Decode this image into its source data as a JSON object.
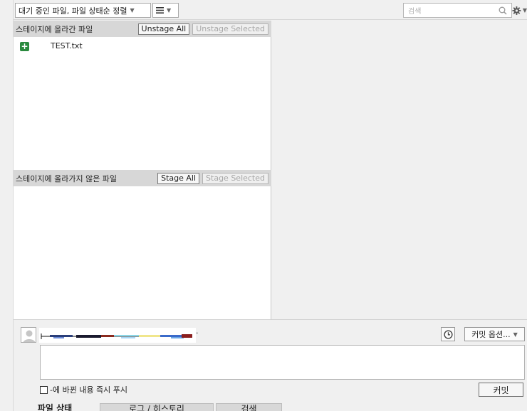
{
  "toolbar": {
    "view_mode": "대기 중인 파일, 파일 상태순 정렬",
    "list_icon": "list-icon",
    "search_placeholder": "검색",
    "search_icon": "search-icon",
    "settings_icon": "gear-icon"
  },
  "staged": {
    "title": "스테이지에 올라간 파일",
    "unstage_all": "Unstage All",
    "unstage_selected": "Unstage Selected",
    "files": [
      {
        "name": "TEST.txt",
        "status": "added",
        "status_icon": "plus-icon",
        "status_color": "#2a8a3e"
      }
    ]
  },
  "unstaged": {
    "title": "스테이지에 올라가지 않은 파일",
    "stage_all": "Stage All",
    "stage_selected": "Stage Selected",
    "files": []
  },
  "commit": {
    "avatar_icon": "user-avatar-icon",
    "author_suffix": "·",
    "history_icon": "clock-icon",
    "options_label": "커밋 옵션...",
    "message": "",
    "push_label": "-에 바뀐 내용 즉시 푸시",
    "push_checked": false,
    "commit_label": "커밋"
  },
  "tabs": [
    {
      "label": "파일 상태",
      "active": true
    },
    {
      "label": "로그 / 히스토리",
      "active": false
    },
    {
      "label": "검색",
      "active": false
    }
  ]
}
